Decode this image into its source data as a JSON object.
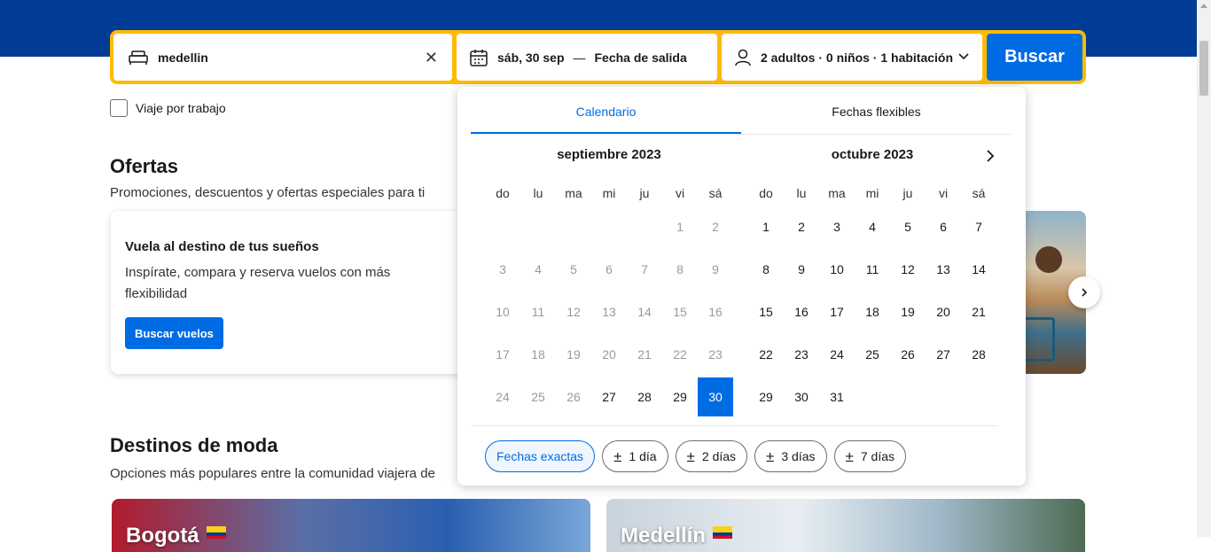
{
  "search": {
    "destination": "medellin",
    "start_date": "sáb, 30 sep",
    "separator": "—",
    "end_placeholder": "Fecha de salida",
    "guests": "2 adultos · 0 niños · 1 habitación",
    "button": "Buscar"
  },
  "work_trip": {
    "label": "Viaje por trabajo",
    "checked": false
  },
  "offers": {
    "title": "Ofertas",
    "subtitle": "Promociones, descuentos y ofertas especiales para ti",
    "card": {
      "title": "Vuela al destino de tus sueños",
      "description": "Inspírate, compara y reserva vuelos con más flexibilidad",
      "button": "Buscar vuelos"
    }
  },
  "trending": {
    "title": "Destinos de moda",
    "subtitle": "Opciones más populares entre la comunidad viajera de",
    "cards": [
      "Bogotá",
      "Medellín"
    ]
  },
  "calendar": {
    "tabs": [
      "Calendario",
      "Fechas flexibles"
    ],
    "active_tab": "Calendario",
    "weekdays": [
      "do",
      "lu",
      "ma",
      "mi",
      "ju",
      "vi",
      "sá"
    ],
    "months": [
      {
        "title": "septiembre 2023",
        "offset": 5,
        "days": 30,
        "past_until": 26,
        "selected": 30
      },
      {
        "title": "octubre 2023",
        "offset": 0,
        "days": 31,
        "past_until": 0,
        "selected": null
      }
    ],
    "flex_options": [
      "Fechas exactas",
      "1 día",
      "2 días",
      "3 días",
      "7 días"
    ],
    "active_option": "Fechas exactas"
  },
  "colors": {
    "brand": "#003b95",
    "accent": "#006ce4",
    "highlight": "#febb02"
  }
}
